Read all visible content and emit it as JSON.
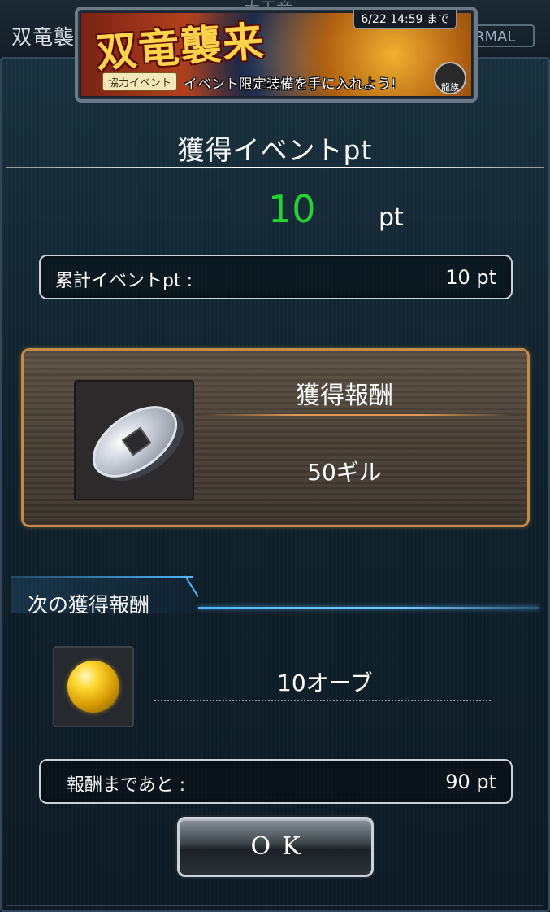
{
  "background": {
    "title": "双竜襲",
    "subtitle": "大王竜",
    "mode": "RMAL"
  },
  "banner": {
    "logo": "双竜襲来",
    "deadline": "6/22 14:59 まで",
    "tag": "協力イベント",
    "catchphrase": "イベント限定装備を手に入れよう!",
    "emblem": "龍族"
  },
  "dialog": {
    "title": "獲得イベントpt",
    "earned_value": "10",
    "earned_unit": "pt",
    "total_label": "累計イベントpt :",
    "total_value": "10 pt"
  },
  "reward": {
    "title": "獲得報酬",
    "name": "50ギル",
    "icon": "coin-icon"
  },
  "next_reward": {
    "header": "次の獲得報酬",
    "name": "10オーブ",
    "icon": "orb-icon",
    "remaining_label": "報酬まであと :",
    "remaining_value": "90 pt"
  },
  "buttons": {
    "ok": "OK"
  },
  "colors": {
    "earned_value": "#24d232",
    "reward_border": "#c58a45",
    "section_accent": "#4fb6ff"
  }
}
